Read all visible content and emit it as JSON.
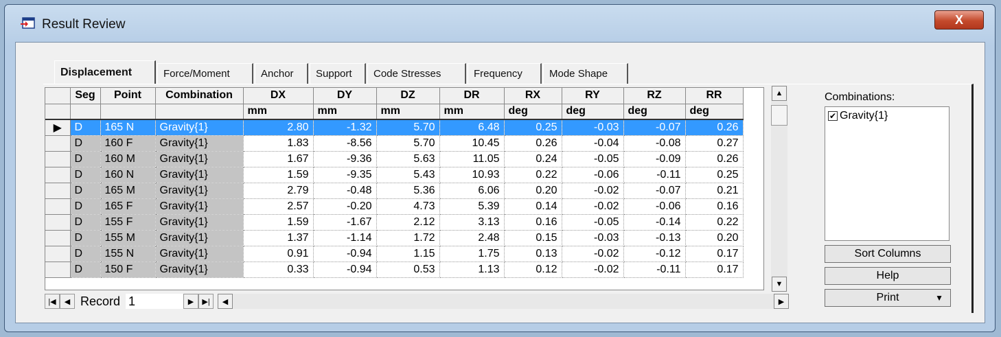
{
  "window": {
    "title": "Result Review",
    "close_label": "X"
  },
  "tabs": [
    {
      "label": "Displacement",
      "active": true
    },
    {
      "label": "Force/Moment"
    },
    {
      "label": "Anchor"
    },
    {
      "label": "Support"
    },
    {
      "label": "Code Stresses"
    },
    {
      "label": "Frequency"
    },
    {
      "label": "Mode Shape"
    }
  ],
  "table": {
    "headers": [
      "Seg",
      "Point",
      "Combination",
      "DX",
      "DY",
      "DZ",
      "DR",
      "RX",
      "RY",
      "RZ",
      "RR"
    ],
    "units": [
      "",
      "",
      "",
      "mm",
      "mm",
      "mm",
      "mm",
      "deg",
      "deg",
      "deg",
      "deg"
    ],
    "rows": [
      [
        "D",
        "165 N",
        "Gravity{1}",
        "2.80",
        "-1.32",
        "5.70",
        "6.48",
        "0.25",
        "-0.03",
        "-0.07",
        "0.26"
      ],
      [
        "D",
        "160 F",
        "Gravity{1}",
        "1.83",
        "-8.56",
        "5.70",
        "10.45",
        "0.26",
        "-0.04",
        "-0.08",
        "0.27"
      ],
      [
        "D",
        "160 M",
        "Gravity{1}",
        "1.67",
        "-9.36",
        "5.63",
        "11.05",
        "0.24",
        "-0.05",
        "-0.09",
        "0.26"
      ],
      [
        "D",
        "160 N",
        "Gravity{1}",
        "1.59",
        "-9.35",
        "5.43",
        "10.93",
        "0.22",
        "-0.06",
        "-0.11",
        "0.25"
      ],
      [
        "D",
        "165 M",
        "Gravity{1}",
        "2.79",
        "-0.48",
        "5.36",
        "6.06",
        "0.20",
        "-0.02",
        "-0.07",
        "0.21"
      ],
      [
        "D",
        "165 F",
        "Gravity{1}",
        "2.57",
        "-0.20",
        "4.73",
        "5.39",
        "0.14",
        "-0.02",
        "-0.06",
        "0.16"
      ],
      [
        "D",
        "155 F",
        "Gravity{1}",
        "1.59",
        "-1.67",
        "2.12",
        "3.13",
        "0.16",
        "-0.05",
        "-0.14",
        "0.22"
      ],
      [
        "D",
        "155 M",
        "Gravity{1}",
        "1.37",
        "-1.14",
        "1.72",
        "2.48",
        "0.15",
        "-0.03",
        "-0.13",
        "0.20"
      ],
      [
        "D",
        "155 N",
        "Gravity{1}",
        "0.91",
        "-0.94",
        "1.15",
        "1.75",
        "0.13",
        "-0.02",
        "-0.12",
        "0.17"
      ],
      [
        "D",
        "150 F",
        "Gravity{1}",
        "0.33",
        "-0.94",
        "0.53",
        "1.13",
        "0.12",
        "-0.02",
        "-0.11",
        "0.17"
      ]
    ]
  },
  "navigator": {
    "label": "Record",
    "value": "1"
  },
  "combinations": {
    "label": "Combinations:",
    "items": [
      {
        "label": "Gravity{1}",
        "checked": true
      }
    ]
  },
  "buttons": {
    "sort": "Sort Columns",
    "help": "Help",
    "print": "Print"
  }
}
